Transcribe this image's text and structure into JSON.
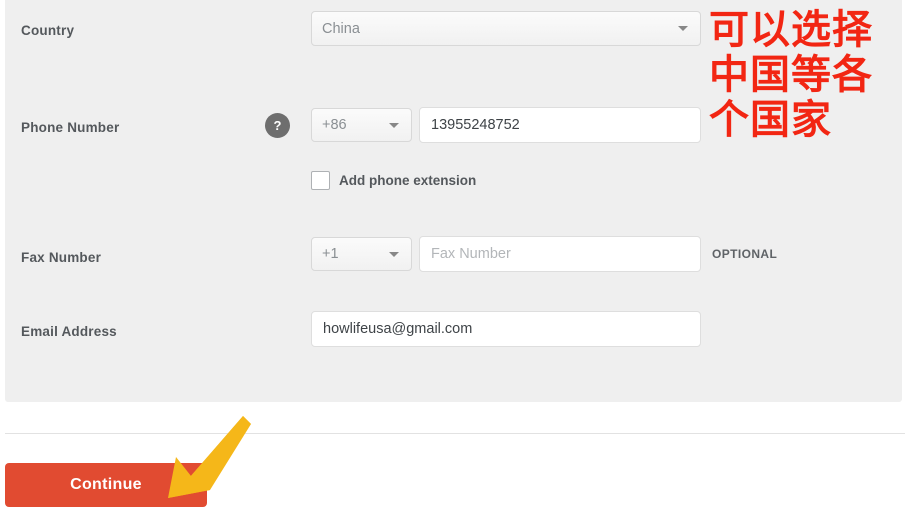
{
  "form": {
    "fields": [
      {
        "label": "Country",
        "control": "select",
        "value": "China"
      },
      {
        "label": "Phone Number",
        "help_icon": "question-mark-icon",
        "help_text": "?",
        "country_code": "+86",
        "value": "13955248752",
        "checkbox_label": "Add phone extension",
        "checkbox_checked": false
      },
      {
        "label": "Fax Number",
        "country_code": "+1",
        "placeholder": "Fax Number",
        "optional_tag": "OPTIONAL"
      },
      {
        "label": "Email Address",
        "value": "howlifeusa@gmail.com"
      }
    ]
  },
  "footer": {
    "continue_label": "Continue"
  },
  "annotations": {
    "red_text_lines": [
      "可以选择",
      "中国等各",
      "个国家"
    ],
    "red_text_full": "可以选择中国等各个国家",
    "arrow_icon": "arrow-down-left-icon"
  },
  "colors": {
    "panel_background": "#efefef",
    "page_background": "#ffffff",
    "label_text": "#54585c",
    "input_text": "#3e4347",
    "placeholder_text": "#b3b6b9",
    "continue_button": "#e14b31",
    "annotation_red": "#f22613",
    "annotation_yellow": "#f5b719",
    "help_badge": "#6e6e6e"
  }
}
